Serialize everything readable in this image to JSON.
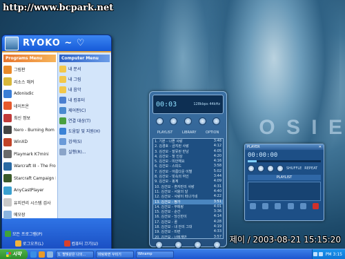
{
  "watermark": {
    "url": "http://www.bcpark.net"
  },
  "wallpaper": {
    "text": "O S I E",
    "datestamp": "제이 / 2003-08-21 15:15:20"
  },
  "start_menu": {
    "user_name": "RYOKO ~ ♡",
    "left_header": "Programs Menu",
    "right_header": "Computer Menu",
    "left_items": [
      {
        "label": "그림판",
        "icon_color": "#e98a2a",
        "icon": "paint-icon"
      },
      {
        "label": "리소스 해커",
        "icon_color": "#d8b73a",
        "icon": "reshacker-icon"
      },
      {
        "label": "Adonisdic",
        "icon_color": "#3a7ed6",
        "icon": "dictionary-icon"
      },
      {
        "label": "네이트온",
        "icon_color": "#e55a2e",
        "icon": "nateon-icon"
      },
      {
        "label": "최신 정보",
        "icon_color": "#c03a3a",
        "icon": "update-icon"
      },
      {
        "label": "Nero - Burning Rom",
        "icon_color": "#444444",
        "icon": "nero-icon"
      },
      {
        "label": "WinXD",
        "icon_color": "#c0442a",
        "icon": "winxd-icon"
      },
      {
        "label": "Playmark K7mini",
        "icon_color": "#6a6a6a",
        "icon": "playmark-icon"
      },
      {
        "label": "Warcraft III - The Frozen Throne",
        "icon_color": "#2a6aa4",
        "icon": "warcraft-icon"
      },
      {
        "label": "Starcraft Campaign Editor",
        "icon_color": "#3a5a2a",
        "icon": "starcraft-icon"
      },
      {
        "label": "AnyCastPlayer",
        "icon_color": "#3aa0d0",
        "icon": "anycast-icon"
      },
      {
        "label": "유지관리 시스템 검사",
        "icon_color": "#c8c8c8",
        "icon": "maintenance-icon"
      },
      {
        "label": "메모장",
        "icon_color": "#8ab4e0",
        "icon": "notepad-icon"
      }
    ],
    "right_items": [
      {
        "label": "내 문서",
        "icon_color": "#f2c74a",
        "icon": "folder-icon"
      },
      {
        "label": "내 그림",
        "icon_color": "#f2c74a",
        "icon": "folder-icon"
      },
      {
        "label": "내 음악",
        "icon_color": "#f2c74a",
        "icon": "folder-icon"
      },
      {
        "label": "내 컴퓨터",
        "icon_color": "#4a7fd0",
        "icon": "computer-icon"
      },
      {
        "label": "제어판(C)",
        "icon_color": "#4a8ad0",
        "icon": "control-panel-icon"
      },
      {
        "label": "연결 대상(T)",
        "icon_color": "#4aa040",
        "icon": "network-icon"
      },
      {
        "label": "도움말 및 지원(H)",
        "icon_color": "#3a82d6",
        "icon": "help-icon"
      },
      {
        "label": "검색(S)",
        "icon_color": "#6a9ad8",
        "icon": "search-icon"
      },
      {
        "label": "실행(R)...",
        "icon_color": "#8aa4c8",
        "icon": "run-icon"
      }
    ],
    "all_programs": "모든 프로그램(P)",
    "logoff": "로그오프(L)",
    "shutdown": "컴퓨터 끄기(U)"
  },
  "main_player": {
    "time": "00:03",
    "track_info": "128kbps 44kHz",
    "tabs": [
      "PLAYLIST",
      "LIBRARY",
      "OPTION"
    ],
    "playlist": [
      {
        "title": "1. 기본 - 나쁜 사랑",
        "dur": "3:48"
      },
      {
        "title": "2. 김경호 - 금지된 사랑",
        "dur": "4:12"
      },
      {
        "title": "3. 김건모 - 잘못된 만남",
        "dur": "4:05"
      },
      {
        "title": "4. 김건모 - 첫 인상",
        "dur": "4:20"
      },
      {
        "title": "5. 김건모 - 미안해요",
        "dur": "4:16"
      },
      {
        "title": "6. 김건모 - 스피드",
        "dur": "3:58"
      },
      {
        "title": "7. 김건모 - 아름다운 이별",
        "dur": "5:02"
      },
      {
        "title": "8. 김건모 - 빗속의 여인",
        "dur": "3:44"
      },
      {
        "title": "9. 김건모 - 핑계",
        "dur": "4:09"
      },
      {
        "title": "10. 김건모 - 혼자만의 사랑",
        "dur": "4:31"
      },
      {
        "title": "11. 김건모 - 서울의 달",
        "dur": "4:40"
      },
      {
        "title": "12. 김건모 - 사랑이 떠나가네",
        "dur": "4:22"
      },
      {
        "title": "13. 김건모 - 짱가",
        "dur": "3:51"
      },
      {
        "title": "14. 김건모 - 부메랑",
        "dur": "4:01"
      },
      {
        "title": "15. 김건모 - 순간",
        "dur": "3:36"
      },
      {
        "title": "16. 김건모 - 당신만이",
        "dur": "4:14"
      },
      {
        "title": "17. 김건모 - 꿈",
        "dur": "4:28"
      },
      {
        "title": "18. 김건모 - 내 안의 그대",
        "dur": "4:19"
      },
      {
        "title": "19. 김건모 - 미련",
        "dur": "4:33"
      },
      {
        "title": "20. 김건모 - 너에게만",
        "dur": "3:57"
      }
    ],
    "selected_index": 12
  },
  "mini_player": {
    "title": "PLAYER",
    "time": "00:00:00",
    "progress": 0.12,
    "playlist_header": "PLAYLIST",
    "options": [
      "SHUFFLE",
      "REPEAT"
    ]
  },
  "taskbar": {
    "start_label": "시작",
    "tasks": [
      "1. 별빛같은 나의...",
      "바탕화면 꾸미기",
      "Winamp"
    ],
    "clock": "PM 3:15"
  }
}
